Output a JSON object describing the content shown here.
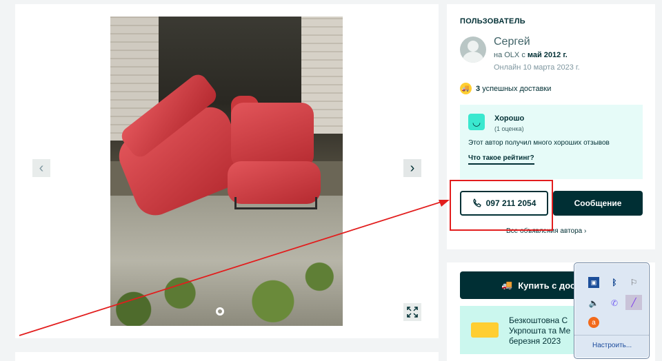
{
  "gallery": {
    "prev_icon": "chevron-left-icon",
    "next_icon": "chevron-right-icon",
    "fullscreen_icon": "fullscreen-icon"
  },
  "user": {
    "section_title": "ПОЛЬЗОВАТЕЛЬ",
    "name": "Сергей",
    "since_prefix": "на OLX с ",
    "since_date": "май 2012 г.",
    "online": "Онлайн 10 марта 2023 г.",
    "deliveries_count": "3",
    "deliveries_label": "успешных доставки"
  },
  "rating": {
    "label": "Хорошо",
    "count": "(1 оценка)",
    "description": "Этот автор получил много хороших отзывов",
    "link": "Что такое рейтинг?"
  },
  "contact": {
    "phone": "097 211 2054",
    "message": "Сообщение",
    "all_ads": "Все объявления автора"
  },
  "buy": {
    "button": "Купить с дост",
    "promo_line1": "Безкоштовна С",
    "promo_line2": "Укрпошта та Ме",
    "promo_line3": "березня 2023"
  },
  "tray": {
    "configure": "Настроить...",
    "icons": [
      "monitor-icon",
      "bluetooth-icon",
      "flag-icon",
      "speaker-icon",
      "viber-icon",
      "pen-icon",
      "avast-icon"
    ]
  },
  "colors": {
    "brand_dark": "#002f34",
    "accent_teal": "#3ae8cf",
    "highlight_red": "#e21d1d"
  }
}
